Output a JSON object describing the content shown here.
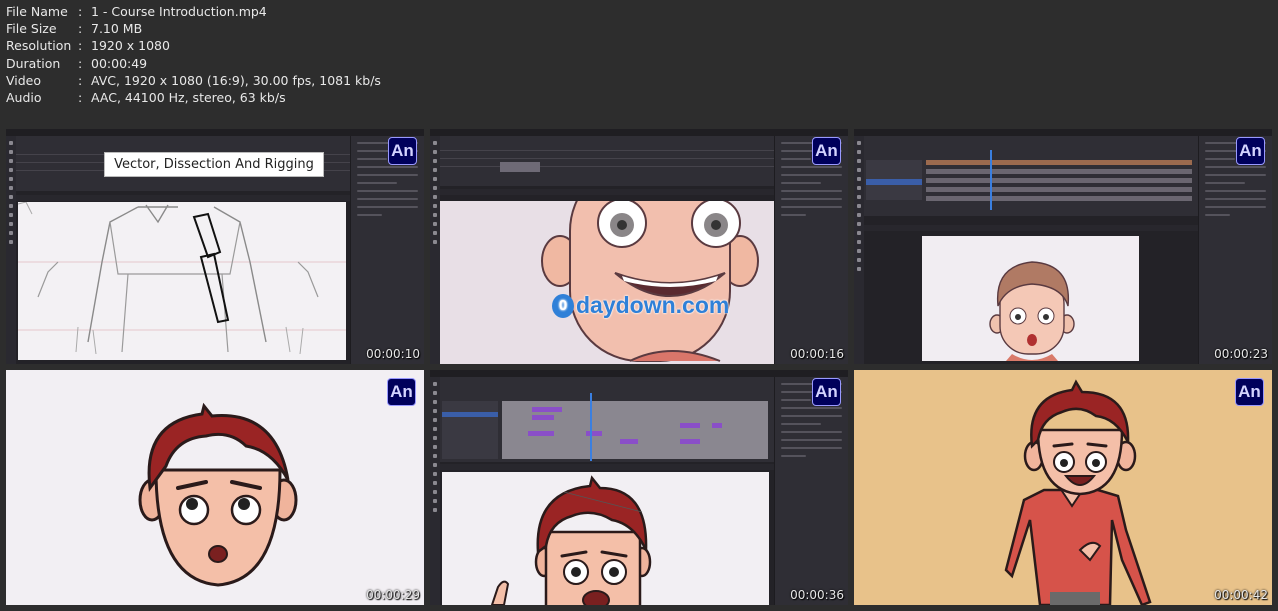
{
  "file_info": [
    {
      "key": "File Name",
      "value": "1 - Course Introduction.mp4"
    },
    {
      "key": "File Size",
      "value": "7.10 MB"
    },
    {
      "key": "Resolution",
      "value": "1920 x 1080"
    },
    {
      "key": "Duration",
      "value": "00:00:49"
    },
    {
      "key": "Video",
      "value": "AVC, 1920 x 1080 (16:9), 30.00 fps, 1081 kb/s"
    },
    {
      "key": "Audio",
      "value": "AAC, 44100 Hz, stereo, 63 kb/s"
    }
  ],
  "separator": ":",
  "badge_text": "An",
  "thumbnails": [
    {
      "timestamp": "00:00:10",
      "caption": "Vector, Dissection And Rigging"
    },
    {
      "timestamp": "00:00:16",
      "watermark": "daydown.com",
      "watermark_mark": "0"
    },
    {
      "timestamp": "00:00:23"
    },
    {
      "timestamp": "00:00:29"
    },
    {
      "timestamp": "00:00:36"
    },
    {
      "timestamp": "00:00:42"
    }
  ],
  "colors": {
    "background": "#2d2d2d",
    "animate_badge": "#00005b",
    "animate_badge_text": "#9999ff",
    "orange_bg": "#e8c28a",
    "stage_light": "#f1edf2"
  }
}
